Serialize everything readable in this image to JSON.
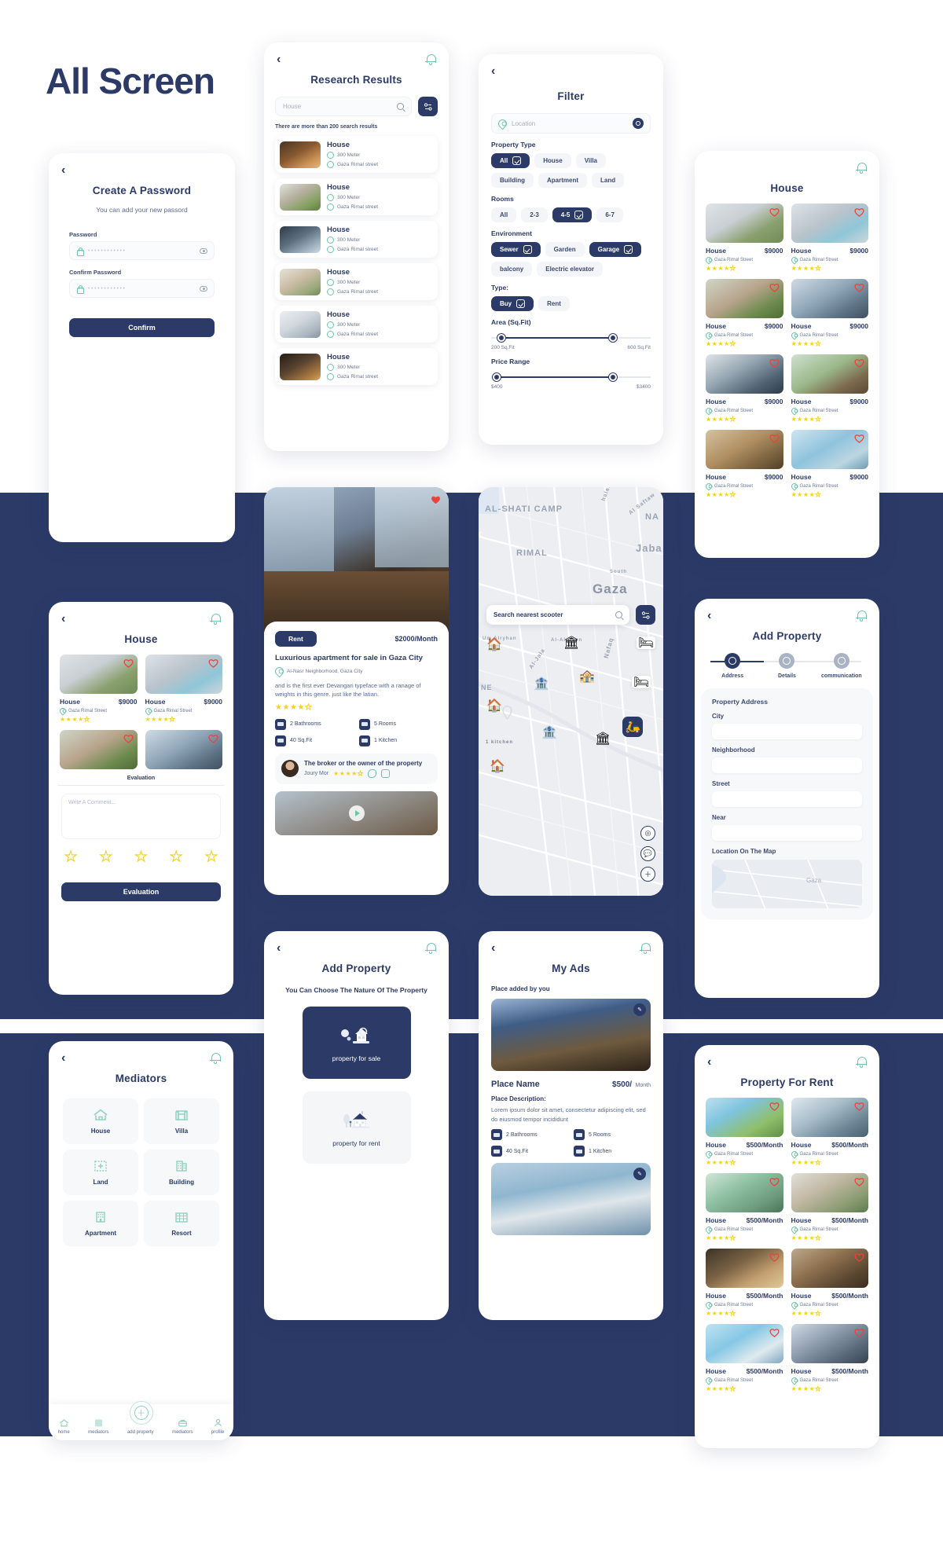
{
  "page": {
    "heading": "All Screen"
  },
  "colors": {
    "navy": "#2b3a67",
    "mint": "#6fc5a8",
    "star": "#f7d117",
    "heart": "#e8443a",
    "bg": "#ffffff"
  },
  "create_password": {
    "back_icon": "chevron-left-icon",
    "title": "Create A Password",
    "subtitle": "You can add your new passord",
    "password_label": "Password",
    "password_value": "••••••••••••",
    "confirm_label": "Confirm Password",
    "confirm_value": "••••••••••••",
    "confirm_button": "Confirm",
    "lock_icon": "lock-icon",
    "eye_icon": "eye-icon"
  },
  "research_results": {
    "title": "Research Results",
    "search_placeholder": "House",
    "search_icon": "search-icon",
    "filter_icon": "filter-icon",
    "results_note": "There are more than 200 search results",
    "items": [
      {
        "name": "House",
        "distance": "300 Meter",
        "address": "Gaza Rimal street"
      },
      {
        "name": "House",
        "distance": "300 Meter",
        "address": "Gaza Rimal street"
      },
      {
        "name": "House",
        "distance": "300 Meter",
        "address": "Gaza Rimal street"
      },
      {
        "name": "House",
        "distance": "300 Meter",
        "address": "Gaza Rimal street"
      },
      {
        "name": "House",
        "distance": "300 Meter",
        "address": "Gaza Rimal street"
      },
      {
        "name": "House",
        "distance": "300 Meter",
        "address": "Gaza Rimal street"
      }
    ]
  },
  "filter": {
    "title": "Filter",
    "location_placeholder": "Location",
    "location_icon": "map-pin-icon",
    "target_icon": "target-icon",
    "property_type_label": "Property Type",
    "property_types": [
      {
        "label": "All",
        "selected": true
      },
      {
        "label": "House",
        "selected": false
      },
      {
        "label": "Villa",
        "selected": false
      },
      {
        "label": "Building",
        "selected": false
      },
      {
        "label": "Apartment",
        "selected": false
      },
      {
        "label": "Land",
        "selected": false
      }
    ],
    "rooms_label": "Rooms",
    "rooms": [
      {
        "label": "All",
        "selected": false
      },
      {
        "label": "2-3",
        "selected": false
      },
      {
        "label": "4-5",
        "selected": true
      },
      {
        "label": "6-7",
        "selected": false
      }
    ],
    "environment_label": "Environment",
    "environment": [
      {
        "label": "Sewer",
        "selected": true
      },
      {
        "label": "Garden",
        "selected": false
      },
      {
        "label": "Garage",
        "selected": true
      },
      {
        "label": "balcony",
        "selected": false
      },
      {
        "label": "Electric elevator",
        "selected": false
      }
    ],
    "type_label": "Type:",
    "types": [
      {
        "label": "Buy",
        "selected": true
      },
      {
        "label": "Rent",
        "selected": false
      }
    ],
    "area_label": "Area (Sq.Fit)",
    "area_min": "200 Sq.Fit",
    "area_max": "600 Sq.Fit",
    "price_label": "Price Range",
    "price_min": "$400",
    "price_max": "$3400"
  },
  "house_list": {
    "title": "House",
    "items": [
      {
        "name": "House",
        "price": "$9000",
        "address": "Gaza Rimal Street",
        "rating": 4
      },
      {
        "name": "House",
        "price": "$9000",
        "address": "Gaza Rimal Street",
        "rating": 4
      },
      {
        "name": "House",
        "price": "$9000",
        "address": "Gaza Rimal Street",
        "rating": 4
      },
      {
        "name": "House",
        "price": "$9000",
        "address": "Gaza Rimal Street",
        "rating": 4
      },
      {
        "name": "House",
        "price": "$9000",
        "address": "Gaza Rimal Street",
        "rating": 4
      },
      {
        "name": "House",
        "price": "$9000",
        "address": "Gaza Rimal Street",
        "rating": 4
      },
      {
        "name": "House",
        "price": "$9000",
        "address": "Gaza Rimal Street",
        "rating": 4
      },
      {
        "name": "House",
        "price": "$9000",
        "address": "Gaza Rimal Street",
        "rating": 4
      }
    ]
  },
  "property_detail": {
    "rent_badge": "Rent",
    "price": "$2000/Month",
    "title": "Luxurious apartment for sale in Gaza City",
    "location": "Al-Nasr Neighborhood, Gaza City",
    "description": "and is the first ever Devangari  typeface with a ranage of weights in this genre. just like the latian.",
    "rating": 4,
    "features": [
      {
        "label": "2 Bathrooms",
        "icon": "bathtub-icon"
      },
      {
        "label": "5 Rooms",
        "icon": "bed-icon"
      },
      {
        "label": "40 Sq.Fit",
        "icon": "area-icon"
      },
      {
        "label": "1 Kitchen",
        "icon": "kitchen-icon"
      }
    ],
    "broker_heading": "The broker or the owner of the property",
    "broker_name": "Joury Mor",
    "broker_rating": 4,
    "call_icon": "phone-icon",
    "message_icon": "message-icon",
    "play_icon": "play-icon"
  },
  "map_screen": {
    "search_placeholder": "Search nearest scooter",
    "search_icon": "search-icon",
    "filter_icon": "filter-icon",
    "labels": [
      {
        "text": "AL-SHATI CAMP",
        "size": 11
      },
      {
        "text": "RIMAL",
        "size": 11
      },
      {
        "text": "Gaza",
        "size": 17
      },
      {
        "text": "Jaba",
        "size": 13
      },
      {
        "text": "NA",
        "size": 11
      },
      {
        "text": "Al Saftaw",
        "size": 7
      },
      {
        "text": "halaf",
        "size": 7
      },
      {
        "text": "Al-Jala",
        "size": 7
      },
      {
        "text": "Nafaq",
        "size": 8
      },
      {
        "text": "Um Alryhan",
        "size": 6
      },
      {
        "text": "Al-Al Deen",
        "size": 6
      },
      {
        "text": "South",
        "size": 6
      },
      {
        "text": "NE",
        "size": 9
      },
      {
        "text": "1 kitchen",
        "size": 6
      },
      {
        "text": "Al-Jala",
        "size": 6
      }
    ],
    "locate_icon": "locate-icon",
    "chat_icon": "chat-icon",
    "plus_icon": "plus-icon"
  },
  "evaluation": {
    "title": "House",
    "items": [
      {
        "name": "House",
        "price": "$9000",
        "address": "Gaza Rimal Street",
        "rating": 4
      },
      {
        "name": "House",
        "price": "$9000",
        "address": "Gaza Rimal Street",
        "rating": 4
      }
    ],
    "divider_label": "Evaluation",
    "comment_placeholder": "Write A Comment...",
    "stars": 5,
    "button": "Evaluation"
  },
  "add_property_form": {
    "title": "Add Property",
    "steps": [
      {
        "label": "Address",
        "icon": "map-pin-icon",
        "active": true
      },
      {
        "label": "Details",
        "icon": "lock-icon",
        "active": false
      },
      {
        "label": "communication",
        "icon": "phone-icon",
        "active": false
      }
    ],
    "section": "Property Address",
    "fields": [
      {
        "label": "City",
        "value": ""
      },
      {
        "label": "Neighborhood",
        "value": ""
      },
      {
        "label": "Street",
        "value": ""
      },
      {
        "label": "Near",
        "value": ""
      }
    ],
    "map_label": "Location On The Map",
    "map_city": "Gaza"
  },
  "mediators": {
    "title": "Mediators",
    "categories": [
      {
        "label": "House",
        "icon": "house-icon"
      },
      {
        "label": "Villa",
        "icon": "villa-icon"
      },
      {
        "label": "Land",
        "icon": "land-icon"
      },
      {
        "label": "Building",
        "icon": "building-icon"
      },
      {
        "label": "Apartment",
        "icon": "apartment-icon"
      },
      {
        "label": "Resort",
        "icon": "resort-icon"
      }
    ],
    "nav": [
      {
        "label": "home",
        "icon": "home-icon"
      },
      {
        "label": "mediators",
        "icon": "grid-icon"
      },
      {
        "label": "add property",
        "icon": "plus-circle-icon"
      },
      {
        "label": "mediators",
        "icon": "briefcase-icon"
      },
      {
        "label": "profile",
        "icon": "user-icon"
      }
    ]
  },
  "add_property_nature": {
    "title": "Add Property",
    "subtitle": "You Can Choose The Nature Of The Property",
    "options": [
      {
        "label": "property for sale",
        "selected": true,
        "icon": "house-sale-icon"
      },
      {
        "label": "property for rent",
        "selected": false,
        "icon": "house-rent-icon"
      }
    ]
  },
  "my_ads": {
    "title": "My Ads",
    "subtitle": "Place added by you",
    "edit_icon": "edit-icon",
    "ad": {
      "name": "Place Name",
      "price": "$500/",
      "price_unit": "Month",
      "desc_label": "Place Description:",
      "description": "Lorem ipsum dolor sit amet, consectetur adipiscing elit, sed do eiusmod tempor incididunt",
      "features": [
        {
          "label": "2 Bathrooms"
        },
        {
          "label": "5 Rooms"
        },
        {
          "label": "40 Sq.Fit"
        },
        {
          "label": "1 Kitchen"
        }
      ]
    }
  },
  "property_for_rent": {
    "title": "Property For Rent",
    "items": [
      {
        "name": "House",
        "price": "$500/Month",
        "address": "Gaza Rimal Street",
        "rating": 4
      },
      {
        "name": "House",
        "price": "$500/Month",
        "address": "Gaza Rimal Street",
        "rating": 4
      },
      {
        "name": "House",
        "price": "$500/Month",
        "address": "Gaza Rimal Street",
        "rating": 4
      },
      {
        "name": "House",
        "price": "$500/Month",
        "address": "Gaza Rimal Street",
        "rating": 4
      },
      {
        "name": "House",
        "price": "$500/Month",
        "address": "Gaza Rimal Street",
        "rating": 4
      },
      {
        "name": "House",
        "price": "$500/Month",
        "address": "Gaza Rimal Street",
        "rating": 4
      },
      {
        "name": "House",
        "price": "$500/Month",
        "address": "Gaza Rimal Street",
        "rating": 4
      },
      {
        "name": "House",
        "price": "$500/Month",
        "address": "Gaza Rimal Street",
        "rating": 4
      }
    ]
  }
}
